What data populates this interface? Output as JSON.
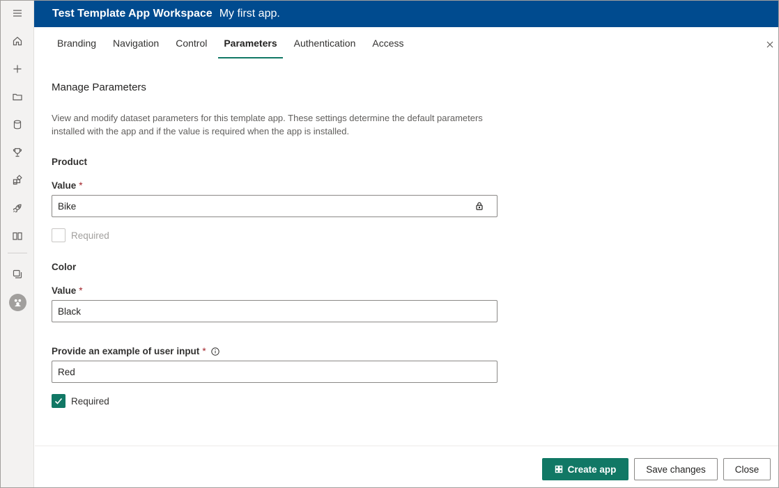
{
  "header": {
    "workspace": "Test Template App Workspace",
    "app_name": "My first app."
  },
  "rail": {
    "icons": [
      "menu-icon",
      "home-icon",
      "plus-icon",
      "folder-icon",
      "database-icon",
      "trophy-icon",
      "apps-icon",
      "rocket-icon",
      "book-icon",
      "workspaces-icon",
      "avatar-icon"
    ]
  },
  "tabs": [
    {
      "label": "Branding"
    },
    {
      "label": "Navigation"
    },
    {
      "label": "Control"
    },
    {
      "label": "Parameters",
      "active": true
    },
    {
      "label": "Authentication"
    },
    {
      "label": "Access"
    }
  ],
  "main": {
    "title": "Manage Parameters",
    "description": "View and modify dataset parameters for this template app. These settings determine the default parameters installed with the app and if the value is required when the app is installed."
  },
  "product": {
    "section": "Product",
    "value_label": "Value",
    "value": "Bike",
    "required_label": "Required",
    "required_checked": false
  },
  "color": {
    "section": "Color",
    "value_label": "Value",
    "value": "Black",
    "example_label": "Provide an example of user input",
    "example_value": "Red",
    "required_label": "Required",
    "required_checked": true
  },
  "required_marker": "*",
  "footer": {
    "create_label": "Create app",
    "save_label": "Save changes",
    "close_label": "Close"
  },
  "colors": {
    "header_bg": "#004b8f",
    "accent": "#117865"
  }
}
